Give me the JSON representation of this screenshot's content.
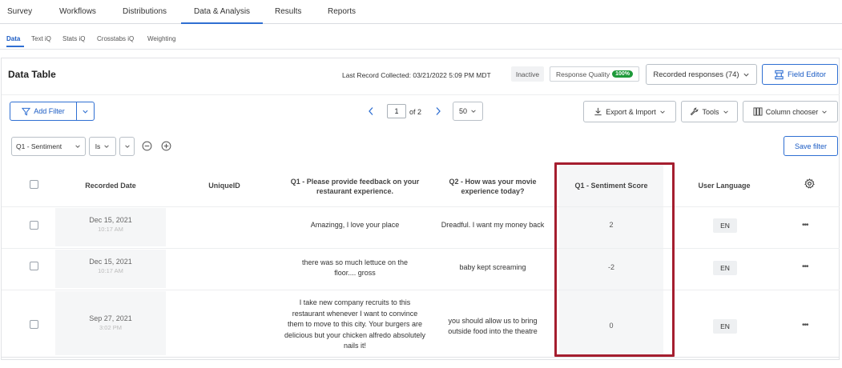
{
  "topnav": {
    "tabs": [
      "Survey",
      "Workflows",
      "Distributions",
      "Data & Analysis",
      "Results",
      "Reports"
    ],
    "active": "Data & Analysis"
  },
  "subnav": {
    "tabs": [
      "Data",
      "Text iQ",
      "Stats iQ",
      "Crosstabs iQ",
      "Weighting"
    ],
    "active": "Data"
  },
  "header": {
    "title": "Data Table",
    "last_record": "Last Record Collected: 03/21/2022 5:09 PM MDT",
    "inactive": "Inactive",
    "response_quality": "Response Quality",
    "response_quality_badge": "100%",
    "recorded_responses": "Recorded responses (74)",
    "field_editor": "Field Editor"
  },
  "toolbar": {
    "add_filter": "Add Filter",
    "page_current": "1",
    "page_of": "of 2",
    "per_page": "50",
    "export_import": "Export & Import",
    "tools": "Tools",
    "column_chooser": "Column chooser"
  },
  "filter": {
    "field": "Q1 - Sentiment",
    "operator": "Is",
    "save": "Save filter"
  },
  "table": {
    "columns": {
      "recorded_date": "Recorded Date",
      "unique_id": "UniqueID",
      "q1": "Q1 - Please provide feedback on your restaurant experience.",
      "q2": "Q2 - How was your movie experience today?",
      "q1_score": "Q1 - Sentiment Score",
      "user_language": "User Language"
    },
    "rows": [
      {
        "date": "Dec 15, 2021",
        "time": "10:17 AM",
        "q1": "Amazingg, I love your place",
        "q2": "Dreadful. I want my money back",
        "score": "2",
        "lang": "EN"
      },
      {
        "date": "Dec 15, 2021",
        "time": "10:17 AM",
        "q1": "there was so much lettuce on the floor.... gross",
        "q2": "baby kept screaming",
        "score": "-2",
        "lang": "EN"
      },
      {
        "date": "Sep 27, 2021",
        "time": "3:02 PM",
        "q1": "I take new company recruits to this restaurant whenever I want to convince them to move to this city. Your burgers are delicious but your chicken alfredo absolutely nails it!",
        "q2": "you should allow us to bring outside food into the theatre",
        "score": "0",
        "lang": "EN"
      }
    ]
  },
  "colors": {
    "accent": "#2f6fd2",
    "highlight": "#a51e2f",
    "badge_green": "#1e9a3a"
  }
}
